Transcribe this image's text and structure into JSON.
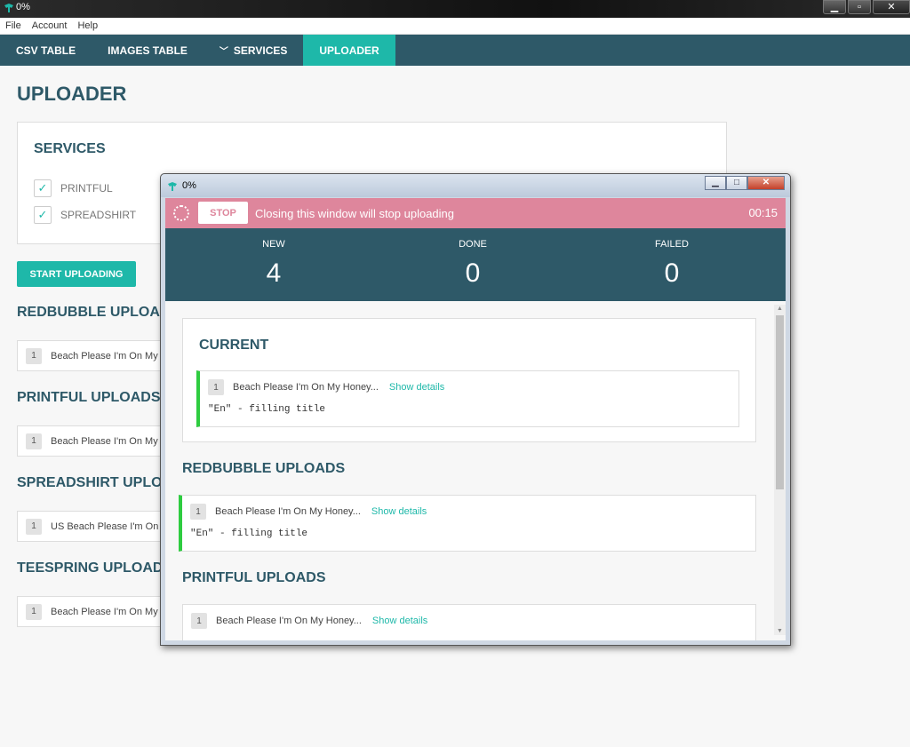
{
  "window": {
    "title": "0%"
  },
  "menu": [
    "File",
    "Account",
    "Help"
  ],
  "nav": {
    "tabs": [
      {
        "label": "CSV TABLE"
      },
      {
        "label": "IMAGES TABLE"
      },
      {
        "label": "SERVICES"
      },
      {
        "label": "UPLOADER"
      }
    ]
  },
  "page": {
    "title": "UPLOADER",
    "services": {
      "heading": "SERVICES",
      "items": [
        {
          "label": "PRINTFUL",
          "checked": true
        },
        {
          "label": "SPREADSHIRT",
          "checked": true
        }
      ]
    },
    "start_button": "START UPLOADING",
    "sections": [
      {
        "heading": "REDBUBBLE UPLOADS",
        "index": "1",
        "item": "Beach Please I'm On My Honey..."
      },
      {
        "heading": "PRINTFUL UPLOADS",
        "index": "1",
        "item": "Beach Please I'm On My Honey..."
      },
      {
        "heading": "SPREADSHIRT UPLOADS",
        "index": "1",
        "item": "US Beach Please I'm On My Honey..."
      },
      {
        "heading": "TEESPRING UPLOADS",
        "index": "1",
        "item": "Beach Please I'm On My Honey..."
      }
    ]
  },
  "popup": {
    "title": "0%",
    "alert": {
      "stop_label": "STOP",
      "message": "Closing this window will stop uploading",
      "timer": "00:15",
      "color": "#de869c"
    },
    "stats": [
      {
        "label": "NEW",
        "value": "4"
      },
      {
        "label": "DONE",
        "value": "0"
      },
      {
        "label": "FAILED",
        "value": "0"
      }
    ],
    "current": {
      "heading": "CURRENT",
      "index": "1",
      "item": "Beach Please I'm On My Honey...",
      "link": "Show details",
      "status": "\"En\" - filling title"
    },
    "redbubble": {
      "heading": "REDBUBBLE UPLOADS",
      "index": "1",
      "item": "Beach Please I'm On My Honey...",
      "link": "Show details",
      "status": "\"En\" - filling title"
    },
    "printful": {
      "heading": "PRINTFUL UPLOADS",
      "index": "1",
      "item": "Beach Please I'm On My Honey...",
      "link": "Show details"
    }
  },
  "colors": {
    "primary": "#2e5968",
    "accent": "#1eb8a9",
    "success": "#2ecc40"
  }
}
